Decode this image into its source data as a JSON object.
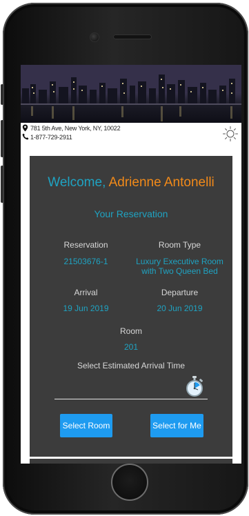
{
  "header": {
    "address": "781 5th Ave, New York, NY, 10022",
    "phone": "1-877-729-2911"
  },
  "welcome": {
    "greeting": "Welcome, ",
    "guest_name": "Adrienne Antonelli"
  },
  "reservation": {
    "title": "Your Reservation",
    "reservation_label": "Reservation",
    "reservation_number": "21503676-1",
    "room_type_label": "Room Type",
    "room_type_line1": "Luxury Executive Room",
    "room_type_line2": "with Two Queen Bed",
    "arrival_label": "Arrival",
    "arrival_date": "19 Jun 2019",
    "departure_label": "Departure",
    "departure_date": "20 Jun 2019",
    "room_label": "Room",
    "room_number": "201",
    "arrival_time_label": "Select Estimated Arrival Time"
  },
  "buttons": {
    "select_room": "Select Room",
    "select_for_me": "Select for Me"
  },
  "colors": {
    "accent": "#1fa3c2",
    "name": "#f28a19",
    "button": "#1e9bf0",
    "card": "#3c3c3c"
  },
  "icons": {
    "location": "map-pin-icon",
    "phone": "phone-icon",
    "theme": "sun-icon",
    "time": "stopwatch-icon"
  }
}
